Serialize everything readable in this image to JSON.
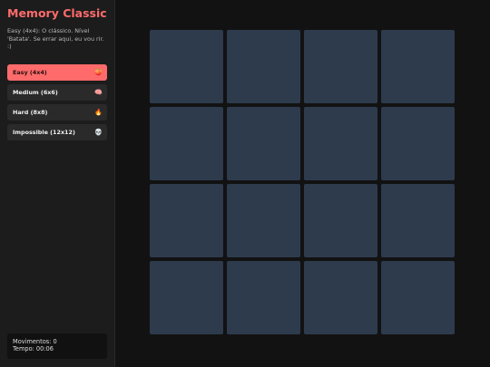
{
  "sidebar": {
    "title": "Memory Classic",
    "description": "Easy (4x4): O clássico. Nível 'Batata'. Se errar aqui, eu vou rir. :)",
    "levels": [
      {
        "label": "Easy (4x4)",
        "icon": "🍑",
        "icon_name": "peach-icon",
        "active": true
      },
      {
        "label": "Medium (6x6)",
        "icon": "🧠",
        "icon_name": "brain-icon",
        "active": false
      },
      {
        "label": "Hard (8x8)",
        "icon": "🔥",
        "icon_name": "fire-icon",
        "active": false
      },
      {
        "label": "Impossible (12x12)",
        "icon": "💀",
        "icon_name": "skull-icon",
        "active": false
      }
    ],
    "stats": {
      "moves": "Movimentos: 0",
      "time": "Tempo: 00:06"
    }
  },
  "board": {
    "rows": 4,
    "cols": 4,
    "card_color": "#2d3b4d"
  },
  "colors": {
    "accent": "#ff6b6b",
    "background": "#121212",
    "sidebar": "#1c1c1c"
  }
}
